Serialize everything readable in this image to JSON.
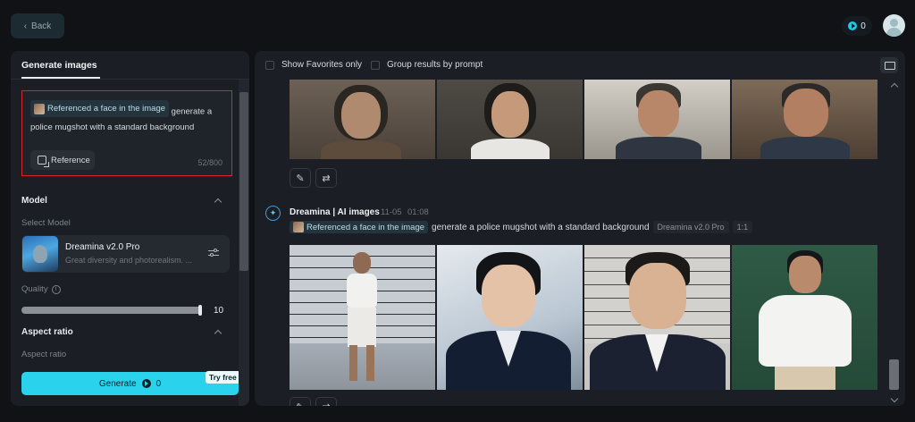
{
  "header": {
    "back_label": "Back",
    "credits": "0"
  },
  "left_panel": {
    "tab": "Generate images",
    "prompt": {
      "reference_chip": "Referenced a face in the image",
      "text": "generate a police mugshot with a standard background",
      "reference_button": "Reference",
      "char_count": "52/800"
    },
    "model": {
      "title": "Model",
      "select_label": "Select Model",
      "name": "Dreamina v2.0 Pro",
      "description": "Great diversity and photorealism. ..."
    },
    "quality": {
      "label": "Quality",
      "value": "10",
      "fraction": 1.0
    },
    "aspect_ratio": {
      "title": "Aspect ratio",
      "sub_label": "Aspect ratio"
    },
    "generate": {
      "label": "Generate",
      "cost": "0",
      "badge": "Try free"
    }
  },
  "right_panel": {
    "filters": {
      "favorites": "Show Favorites only",
      "group": "Group results by prompt"
    },
    "result": {
      "author": "Dreamina | AI images",
      "date": "11-05",
      "time": "01:08",
      "reference_chip": "Referenced a face in the image",
      "prompt": "generate a police mugshot with a standard background",
      "model_tag": "Dreamina v2.0 Pro",
      "ratio_tag": "1:1"
    }
  },
  "colors": {
    "accent": "#2ad2ec",
    "highlight_border": "#d9262e",
    "background": "#101216",
    "panel": "#1b1e24"
  }
}
